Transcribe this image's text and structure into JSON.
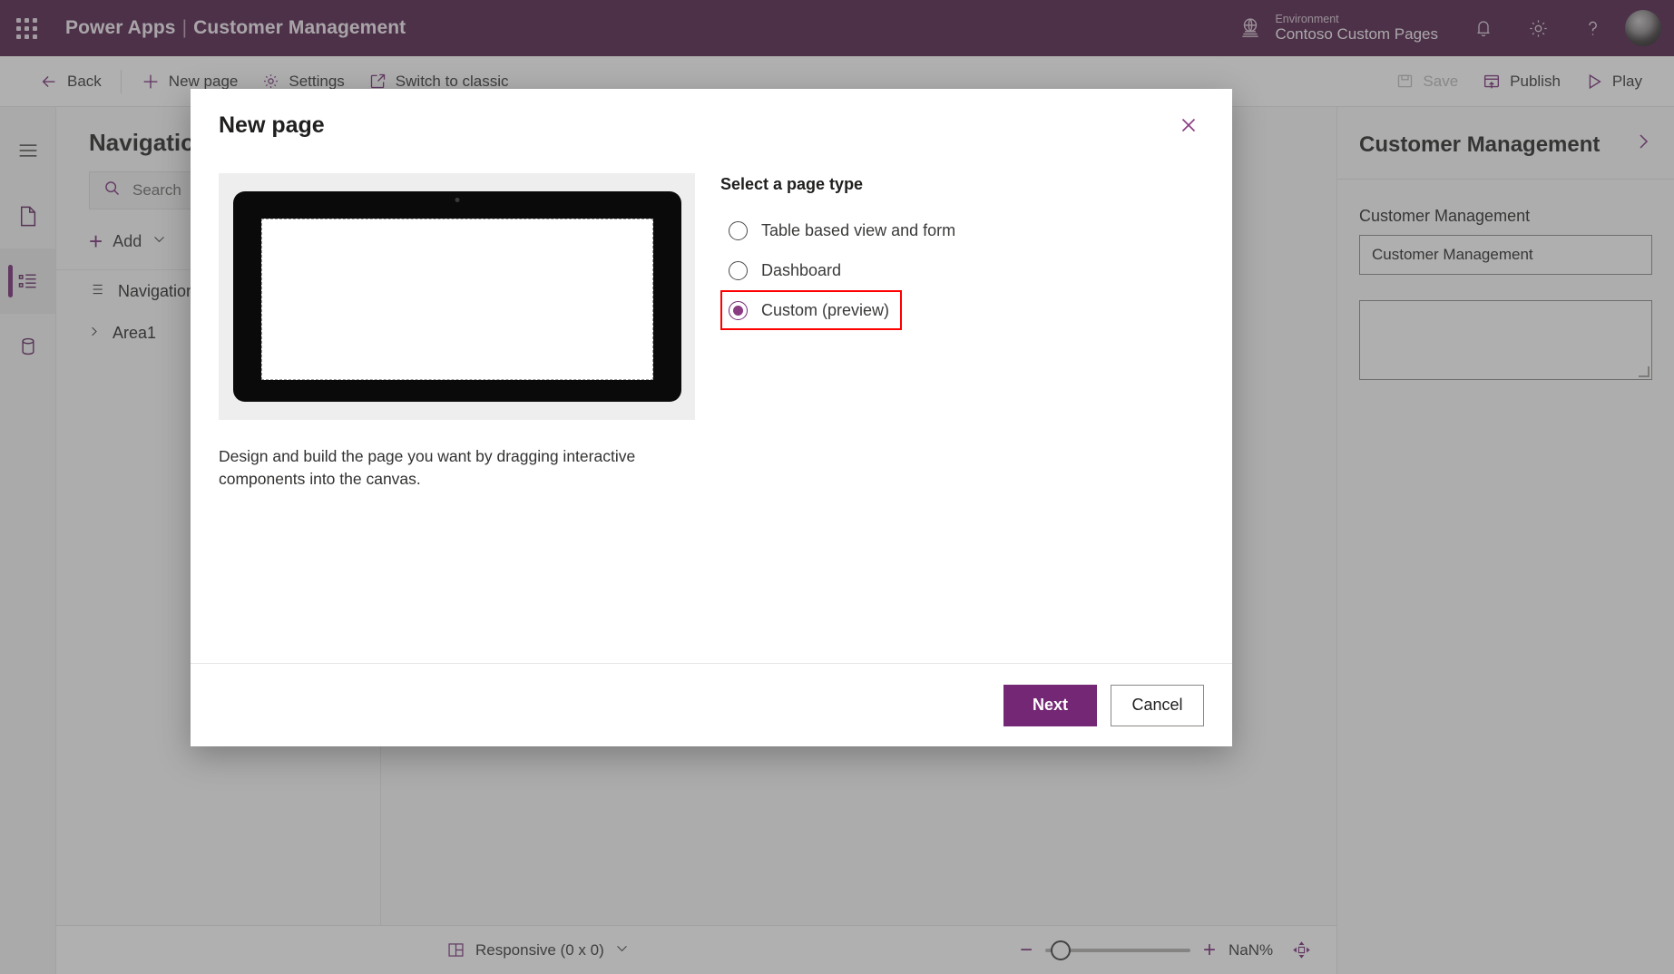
{
  "suitebar": {
    "waffle_title": "App launcher",
    "product": "Power Apps",
    "separator": "|",
    "app_name": "Customer Management",
    "environment_label": "Environment",
    "environment_name": "Contoso Custom Pages",
    "icons": {
      "globe": "globe-icon",
      "notifications": "bell-icon",
      "settings": "gear-icon",
      "help": "question-mark-icon",
      "account": "avatar"
    }
  },
  "commandbar": {
    "back": "Back",
    "new_page": "New page",
    "settings": "Settings",
    "switch_to_classic": "Switch to classic",
    "save": "Save",
    "save_disabled": true,
    "publish": "Publish",
    "play": "Play"
  },
  "rail": {
    "items": [
      {
        "name": "hamburger-menu",
        "label": "Menu"
      },
      {
        "name": "pages",
        "label": "Pages"
      },
      {
        "name": "navigation",
        "label": "Navigation",
        "active": true
      },
      {
        "name": "data",
        "label": "Data"
      }
    ]
  },
  "tree": {
    "title": "Navigation",
    "search_placeholder": "Search",
    "add_label": "Add",
    "nodes": [
      {
        "label": "Navigation",
        "icon": "list-icon",
        "level": 0
      },
      {
        "label": "Area1",
        "icon": "chevron-right-icon",
        "level": 0
      }
    ]
  },
  "properties": {
    "title": "Customer Management",
    "field_label": "Customer Management",
    "field_value": "Customer Management",
    "textarea_value": ""
  },
  "statusbar": {
    "screen_size": "Responsive (0 x 0)",
    "zoom_minus": "−",
    "zoom_plus": "+",
    "zoom_value": "NaN%",
    "fit_icon": "fit-to-screen-icon",
    "slider_percent": 4
  },
  "modal": {
    "title": "New page",
    "close_icon": "close-icon",
    "preview_description": "Design and build the page you want by dragging interactive components into the canvas.",
    "options_title": "Select a page type",
    "options": [
      {
        "label": "Table based view and form",
        "selected": false,
        "highlighted": false
      },
      {
        "label": "Dashboard",
        "selected": false,
        "highlighted": false
      },
      {
        "label": "Custom (preview)",
        "selected": true,
        "highlighted": true
      }
    ],
    "primary_button": "Next",
    "secondary_button": "Cancel"
  },
  "colors": {
    "brand_purple": "#742774",
    "suitebar_purple": "#4a1942",
    "highlight_red": "#ff0000",
    "radio_fill": "#8a3b82"
  }
}
